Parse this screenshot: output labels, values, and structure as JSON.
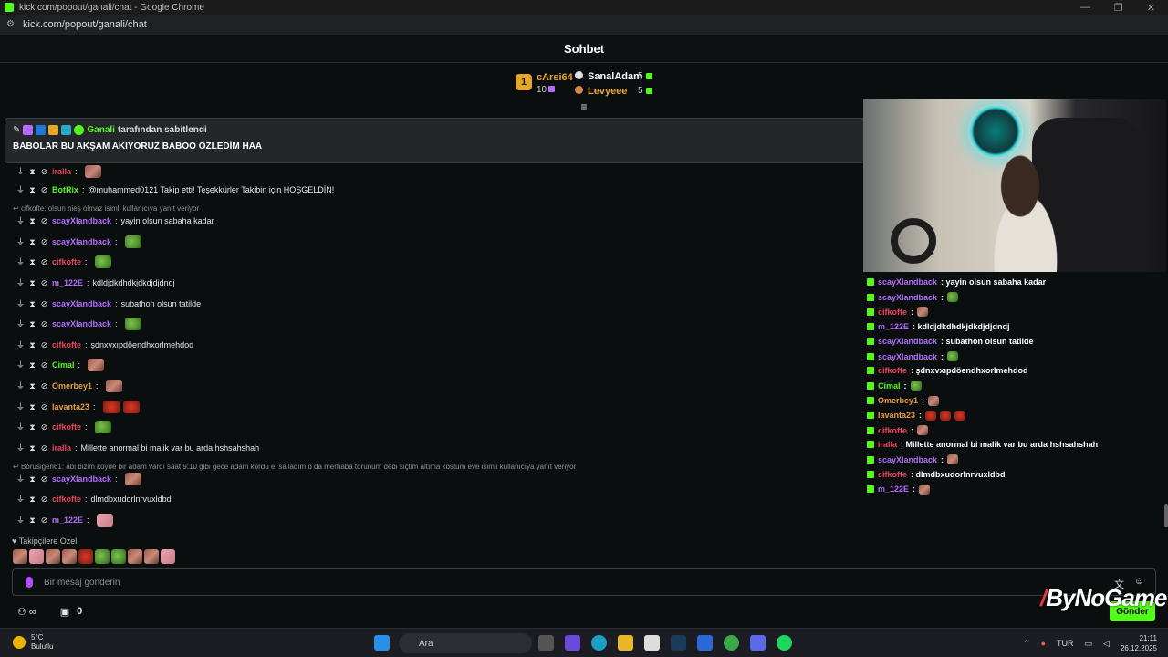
{
  "window": {
    "title": "kick.com/popout/ganali/chat - Google Chrome",
    "url": "kick.com/popout/ganali/chat"
  },
  "chat_header": {
    "title": "Sohbet"
  },
  "leaderboard": {
    "first": {
      "rank": "1",
      "name": "cArsi64",
      "count": "10"
    },
    "second": {
      "name": "SanalAdam",
      "count": "5"
    },
    "third": {
      "name": "Levyeee",
      "count": "5"
    }
  },
  "pinned": {
    "user": "Ganali",
    "suffix": "tarafından sabitlendi",
    "text": "BABOLAR BU AKŞAM AKIYORUZ BABOO ÖZLEDİM HAA"
  },
  "messages": [
    {
      "user": "iralla",
      "text": "",
      "color": "#e8455a"
    },
    {
      "user": "BotRix",
      "text": "@muhammed0121 Takip etti! Teşekkürler Takibin için HOŞGELDİN!",
      "color": "#53fc18"
    },
    {
      "user": "scayXlandback",
      "text": "yayin olsun sabaha kadar",
      "color": "#b36bff"
    },
    {
      "user": "scayXlandback",
      "text": "",
      "color": "#b36bff"
    },
    {
      "user": "cifkofte",
      "text": "",
      "color": "#e8455a"
    },
    {
      "user": "m_122E",
      "text": "kdldjdkdhdkjdkdjdjdndj",
      "color": "#b36bff"
    },
    {
      "user": "scayXlandback",
      "text": "subathon olsun tatilde",
      "color": "#b36bff"
    },
    {
      "user": "scayXlandback",
      "text": "",
      "color": "#b36bff"
    },
    {
      "user": "cifkofte",
      "text": "şdnxvxıpdöendhxorlmehdod",
      "color": "#e8455a"
    },
    {
      "user": "Cimal",
      "text": "",
      "color": "#53fc18"
    },
    {
      "user": "Omerbey1",
      "text": "",
      "color": "#e89a3a"
    },
    {
      "user": "lavanta23",
      "text": "",
      "color": "#e89a3a"
    },
    {
      "user": "cifkofte",
      "text": "",
      "color": "#e8455a"
    },
    {
      "user": "iralla",
      "text": "Millette anormal bi malik var bu arda hshsahshah",
      "color": "#e8455a"
    },
    {
      "user": "scayXlandback",
      "text": "",
      "color": "#b36bff"
    },
    {
      "user": "cifkofte",
      "text": "dlmdbxudorlnrvuxldbd",
      "color": "#e8455a"
    },
    {
      "user": "m_122E",
      "text": "",
      "color": "#b36bff"
    }
  ],
  "replies": [
    {
      "text": "cifkofte: olsun nieş olmaz",
      "suffix": "isimli kullanıcıya yanıt veriyor"
    },
    {
      "text": "Borusigen61: abi bizim köyde bir adam vardı saat 9:10 gibi gece adam kördü el salladım o da merhaba torunum dedi siçtim altıma kostum eve isimli kullanıcıya yanıt veriyor"
    }
  ],
  "followers_label": "Takipçilere Özel",
  "input": {
    "placeholder": "Bir mesaj gönderin"
  },
  "bottom": {
    "points": "0",
    "send": "Gönder"
  },
  "overlay_chat": [
    {
      "user": "scayXlandback",
      "text": ": yayin olsun sabaha kadar",
      "color": "#b36bff"
    },
    {
      "user": "scayXlandback",
      "text": ":",
      "color": "#b36bff"
    },
    {
      "user": "cifkofte",
      "text": ":",
      "color": "#e8455a"
    },
    {
      "user": "m_122E",
      "text": ": kdldjdkdhdkjdkdjdjdndj",
      "color": "#b36bff"
    },
    {
      "user": "scayXlandback",
      "text": ": subathon olsun tatilde",
      "color": "#b36bff"
    },
    {
      "user": "scayXlandback",
      "text": ":",
      "color": "#b36bff"
    },
    {
      "user": "cifkofte",
      "text": ": şdnxvxıpdöendhxorlmehdod",
      "color": "#e8455a"
    },
    {
      "user": "Cimal",
      "text": ":",
      "color": "#53fc18"
    },
    {
      "user": "Omerbey1",
      "text": ":",
      "color": "#e89a3a"
    },
    {
      "user": "lavanta23",
      "text": ":",
      "color": "#e89a3a"
    },
    {
      "user": "cifkofte",
      "text": ":",
      "color": "#e8455a"
    },
    {
      "user": "iralla",
      "text": ": Millette anormal bi malik var bu arda hshsahshah",
      "color": "#e8455a"
    },
    {
      "user": "scayXlandback",
      "text": ":",
      "color": "#b36bff"
    },
    {
      "user": "cifkofte",
      "text": ": dlmdbxudorlnrvuxldbd",
      "color": "#e8455a"
    },
    {
      "user": "m_122E",
      "text": ":",
      "color": "#b36bff"
    }
  ],
  "brand": "ByNoGame",
  "taskbar": {
    "temp": "5°C",
    "weather": "Bulutlu",
    "search": "Ara",
    "lang": "TUR",
    "time": "21:11",
    "date": "26.12.2025"
  }
}
